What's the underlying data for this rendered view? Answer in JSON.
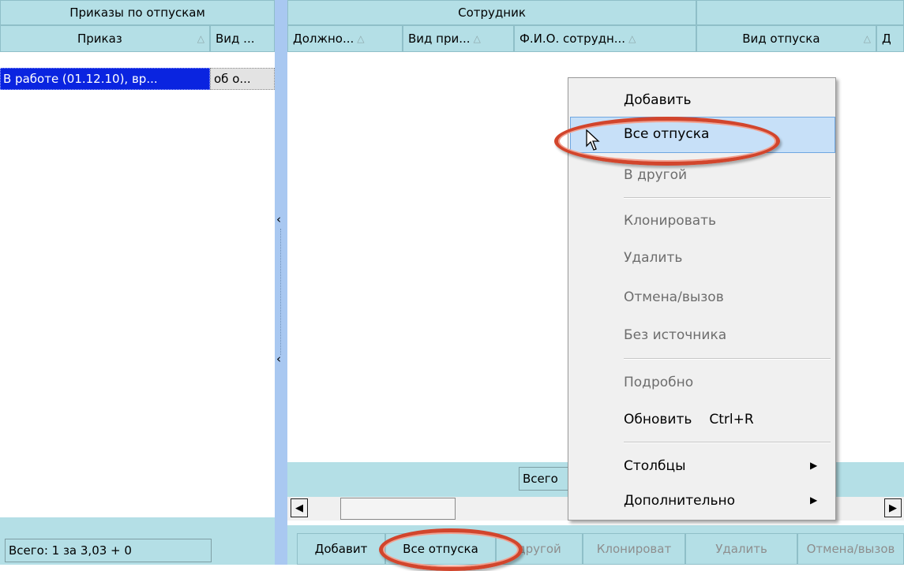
{
  "left": {
    "group_header": "Приказы по отпускам",
    "columns": [
      {
        "label": "Приказ",
        "sort": "△"
      },
      {
        "label": "Вид ..."
      }
    ],
    "rows": [
      {
        "order": "В работе (01.12.10), вр...",
        "kind": "об о..."
      }
    ],
    "status": "Всего: 1 за 3,03 + 0"
  },
  "right": {
    "group_header": "Сотрудник",
    "columns": [
      {
        "label": "Должно...",
        "sort": "△"
      },
      {
        "label": "Вид при...",
        "sort": "△"
      },
      {
        "label": "Ф.И.О. сотрудн...",
        "sort": "△"
      },
      {
        "label": "Вид отпуска",
        "sort": "△"
      },
      {
        "label": "Д"
      }
    ],
    "total_label": "Всего",
    "toolbar": [
      {
        "label": "Добавить",
        "enabled": true
      },
      {
        "label": "Все отпуска",
        "enabled": true
      },
      {
        "label": "В другой",
        "enabled": false
      },
      {
        "label": "Клонировать",
        "enabled": false
      },
      {
        "label": "Удалить",
        "enabled": false
      },
      {
        "label": "Отмена/вызов",
        "enabled": false
      }
    ],
    "toolbar_visible": {
      "add": "Добавит",
      "all": "Все отпуска",
      "other": "другой",
      "clone": "Клонироват",
      "delete": "Удалить",
      "cancel": "Отмена/вызов"
    }
  },
  "context_menu": {
    "items": [
      {
        "label": "Добавить",
        "enabled": true
      },
      {
        "label": "Все отпуска",
        "enabled": true,
        "highlighted": true
      },
      {
        "label": "В другой",
        "enabled": false
      },
      {
        "label": "Клонировать",
        "enabled": false
      },
      {
        "label": "Удалить",
        "enabled": false
      },
      {
        "label": "Отмена/вызов",
        "enabled": false
      },
      {
        "label": "Без источника",
        "enabled": false
      },
      {
        "label": "Подробно",
        "enabled": false
      },
      {
        "label": "Обновить",
        "shortcut": "Ctrl+R",
        "enabled": true
      },
      {
        "label": "Столбцы",
        "submenu": true,
        "enabled": true
      },
      {
        "label": "Дополнительно",
        "submenu": true,
        "enabled": true
      }
    ]
  },
  "colors": {
    "header_bg": "#b4dfe6",
    "selection": "#0a24e0",
    "splitter": "#a9c8f1",
    "menu_highlight": "#c7e0f8",
    "annotation_oval": "#d2452c"
  },
  "icons": {
    "sort": "sort-ascending-icon",
    "splitter_arrow": "chevron-left-icon",
    "scroll_left": "scroll-left-icon",
    "scroll_right": "scroll-right-icon",
    "submenu": "submenu-arrow-icon",
    "cursor": "mouse-cursor-icon"
  }
}
